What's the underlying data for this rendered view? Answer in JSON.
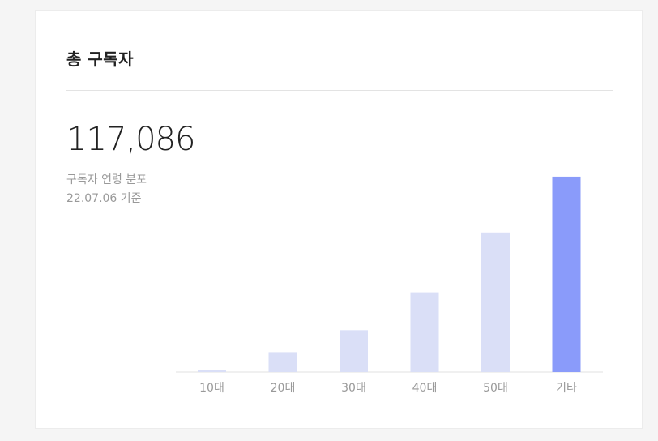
{
  "card": {
    "title": "총 구독자",
    "total": "117,086",
    "subtitle": "구독자 연령 분포",
    "date_note": "22.07.06 기준"
  },
  "chart_data": {
    "type": "bar",
    "categories": [
      "10대",
      "20대",
      "30대",
      "40대",
      "50대",
      "기타"
    ],
    "values": [
      1,
      10,
      21,
      40,
      70,
      98
    ],
    "highlight_index": 5,
    "colors": {
      "bar": "#dadff7",
      "highlight": "#8a9bfa",
      "axis": "#e0e0e0",
      "tick_label": "#999999"
    },
    "ylim": [
      0,
      100
    ],
    "xlabel": "",
    "ylabel": ""
  }
}
